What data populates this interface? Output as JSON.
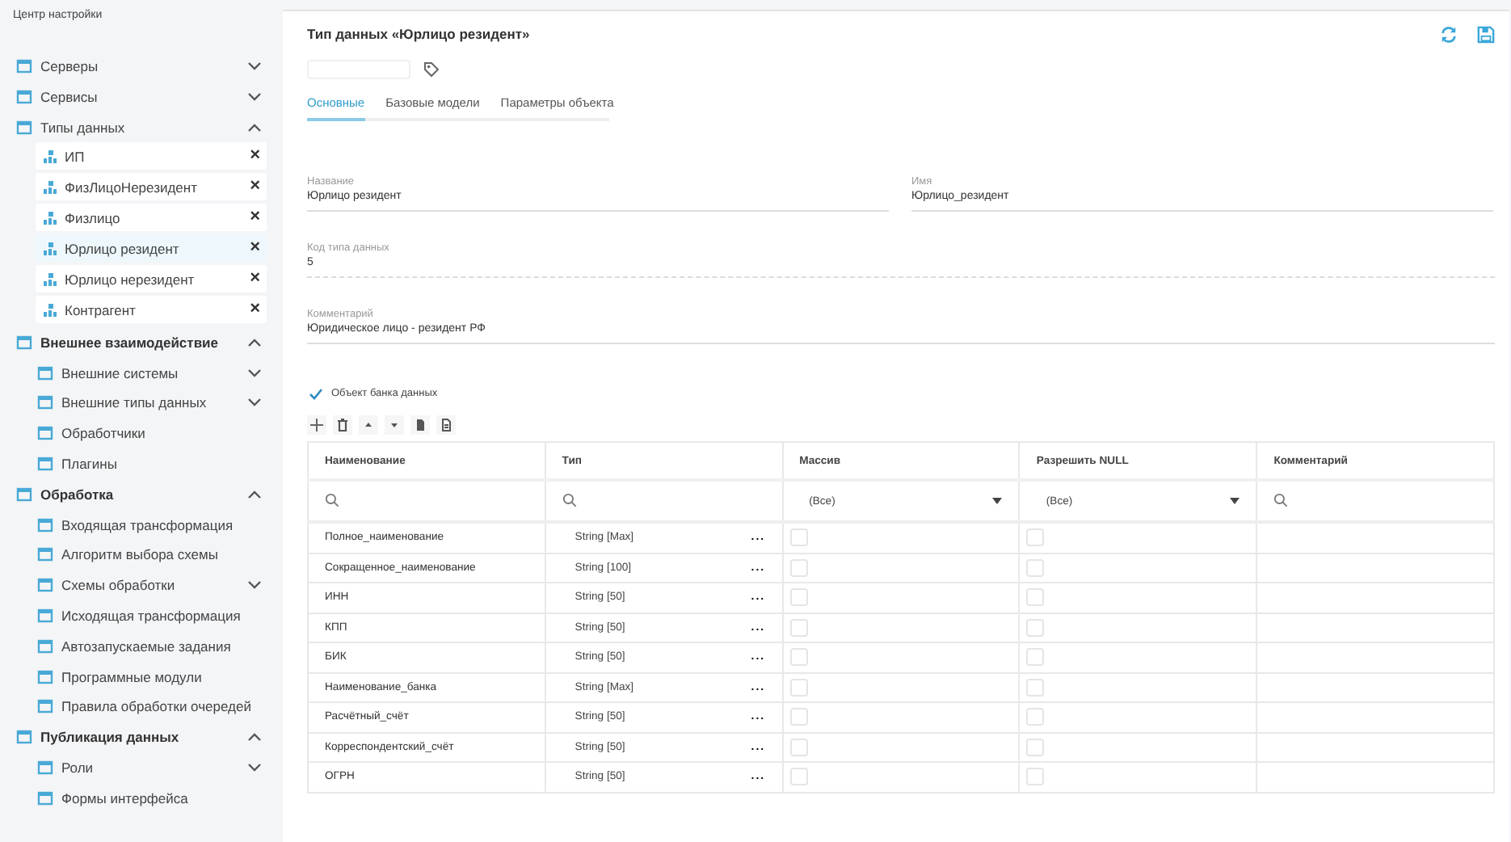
{
  "sidebar": {
    "subtitle": "Центр настройки",
    "items": [
      {
        "kind": "folder",
        "label": "Серверы",
        "bold": false,
        "expanded": false
      },
      {
        "kind": "folder",
        "label": "Сервисы",
        "bold": false,
        "expanded": false
      },
      {
        "kind": "folder",
        "label": "Типы данных",
        "bold": false,
        "expanded": true,
        "children": [
          {
            "kind": "card",
            "label": "ИП",
            "selected": false,
            "close": "×"
          },
          {
            "kind": "card",
            "label": "ФизЛицоНерезидент",
            "selected": false,
            "close": "×"
          },
          {
            "kind": "card",
            "label": "Физлицо",
            "selected": false,
            "close": "×"
          },
          {
            "kind": "card",
            "label": "Юрлицо резидент",
            "selected": true,
            "close": "×"
          },
          {
            "kind": "card",
            "label": "Юрлицо нерезидент",
            "selected": false,
            "close": "×"
          },
          {
            "kind": "card",
            "label": "Контрагент",
            "selected": false,
            "close": "×"
          }
        ]
      },
      {
        "kind": "folder",
        "label": "Внешнее взаимодействие",
        "bold": true,
        "expanded": true,
        "children": [
          {
            "kind": "folder",
            "label": "Внешние системы",
            "expanded": false
          },
          {
            "kind": "folder",
            "label": "Внешние типы данных",
            "expanded": false
          },
          {
            "kind": "leaf",
            "label": "Обработчики"
          },
          {
            "kind": "leaf",
            "label": "Плагины"
          }
        ]
      },
      {
        "kind": "folder",
        "label": "Обработка",
        "bold": true,
        "expanded": true,
        "children": [
          {
            "kind": "leaf",
            "label": "Входящая трансформация"
          },
          {
            "kind": "leaf",
            "label": "Алгоритм выбора схемы"
          },
          {
            "kind": "folder",
            "label": "Схемы обработки",
            "expanded": false
          },
          {
            "kind": "leaf",
            "label": "Исходящая трансформация"
          },
          {
            "kind": "leaf",
            "label": "Автозапускаемые задания"
          },
          {
            "kind": "leaf",
            "label": "Программные модули"
          },
          {
            "kind": "leaf",
            "label": "Правила обработки очередей"
          }
        ]
      },
      {
        "kind": "folder",
        "label": "Публикация данных",
        "bold": true,
        "expanded": true,
        "children": [
          {
            "kind": "folder",
            "label": "Роли",
            "expanded": false
          },
          {
            "kind": "leaf",
            "label": "Формы интерфейса"
          }
        ]
      }
    ]
  },
  "page": {
    "title": "Тип данных «Юрлицо резидент»",
    "tabs": [
      {
        "label": "Основные",
        "selected": true
      },
      {
        "label": "Базовые модели",
        "selected": false
      },
      {
        "label": "Параметры объекта",
        "selected": false
      }
    ],
    "fields": [
      {
        "kind": "half",
        "label": "Название",
        "value": "Юрлицо резидент"
      },
      {
        "kind": "half",
        "label": "Имя",
        "value": "Юрлицо_резидент"
      },
      {
        "kind": "dotted",
        "label": "Код типа данных",
        "value": "5"
      },
      {
        "kind": "full",
        "label": "Комментарий",
        "value": "Юридическое лицо - резидент РФ"
      }
    ],
    "bank_object": {
      "label": "Объект банка данных",
      "checked": true
    },
    "table": {
      "columns": [
        "Наименование",
        "Тип",
        "Массив",
        "Разрешить NULL",
        "Комментарий"
      ],
      "filters": [
        {
          "kind": "search"
        },
        {
          "kind": "search"
        },
        {
          "kind": "select",
          "value": "(Все)"
        },
        {
          "kind": "select",
          "value": "(Все)"
        },
        {
          "kind": "search"
        }
      ],
      "rows": [
        {
          "name": "Полное_наименование",
          "type": "String [Max]",
          "more": "...",
          "array": false,
          "nullable": false
        },
        {
          "name": "Сокращенное_наименование",
          "type": "String [100]",
          "more": "...",
          "array": false,
          "nullable": false
        },
        {
          "name": "ИНН",
          "type": "String [50]",
          "more": "...",
          "array": false,
          "nullable": false
        },
        {
          "name": "КПП",
          "type": "String [50]",
          "more": "...",
          "array": false,
          "nullable": false
        },
        {
          "name": "БИК",
          "type": "String [50]",
          "more": "...",
          "array": false,
          "nullable": false
        },
        {
          "name": "Наименование_банка",
          "type": "String [Max]",
          "more": "...",
          "array": false,
          "nullable": false
        },
        {
          "name": "Расчётный_счёт",
          "type": "String [50]",
          "more": "...",
          "array": false,
          "nullable": false
        },
        {
          "name": "Корреспондентский_счёт",
          "type": "String [50]",
          "more": "...",
          "array": false,
          "nullable": false
        },
        {
          "name": "ОГРН",
          "type": "String [50]",
          "more": "...",
          "array": false,
          "nullable": false
        }
      ]
    }
  }
}
